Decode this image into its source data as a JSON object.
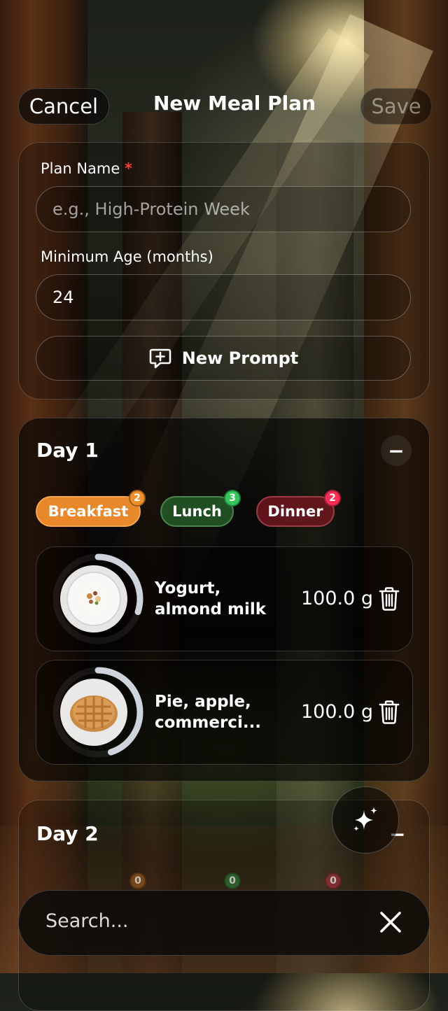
{
  "nav": {
    "cancel_label": "Cancel",
    "title": "New Meal Plan",
    "save_label": "Save"
  },
  "form": {
    "plan_name_label": "Plan Name",
    "required_mark": "*",
    "plan_name_placeholder": "e.g., High-Protein Week",
    "min_age_label": "Minimum Age (months)",
    "min_age_value": "24",
    "new_prompt_label": "New Prompt"
  },
  "days": [
    {
      "title": "Day 1",
      "collapse_symbol": "−",
      "meals": [
        {
          "label": "Breakfast",
          "count": "2",
          "color": "#e8882a"
        },
        {
          "label": "Lunch",
          "count": "3",
          "color": "#34c759"
        },
        {
          "label": "Dinner",
          "count": "2",
          "color": "#ff2d55"
        }
      ],
      "items": [
        {
          "name_line1": "Yogurt,",
          "name_line2": "almond milk",
          "quantity": "100.0 g",
          "progress": 0.3
        },
        {
          "name_line1": "Pie, apple,",
          "name_line2": "commerci...",
          "quantity": "100.0 g",
          "progress": 0.45
        }
      ]
    },
    {
      "title": "Day 2",
      "collapse_symbol": "−",
      "meal_counts": [
        "0",
        "0",
        "0"
      ]
    }
  ],
  "search": {
    "placeholder": "Search..."
  },
  "icons": {
    "new_prompt": "chat-plus-icon",
    "delete": "trash-icon",
    "ai": "sparkles-icon",
    "clear": "close-icon"
  },
  "colors": {
    "required": "#ff3b30",
    "breakfast": "#e8882a",
    "lunch": "#34c759",
    "dinner": "#ff2d55"
  }
}
